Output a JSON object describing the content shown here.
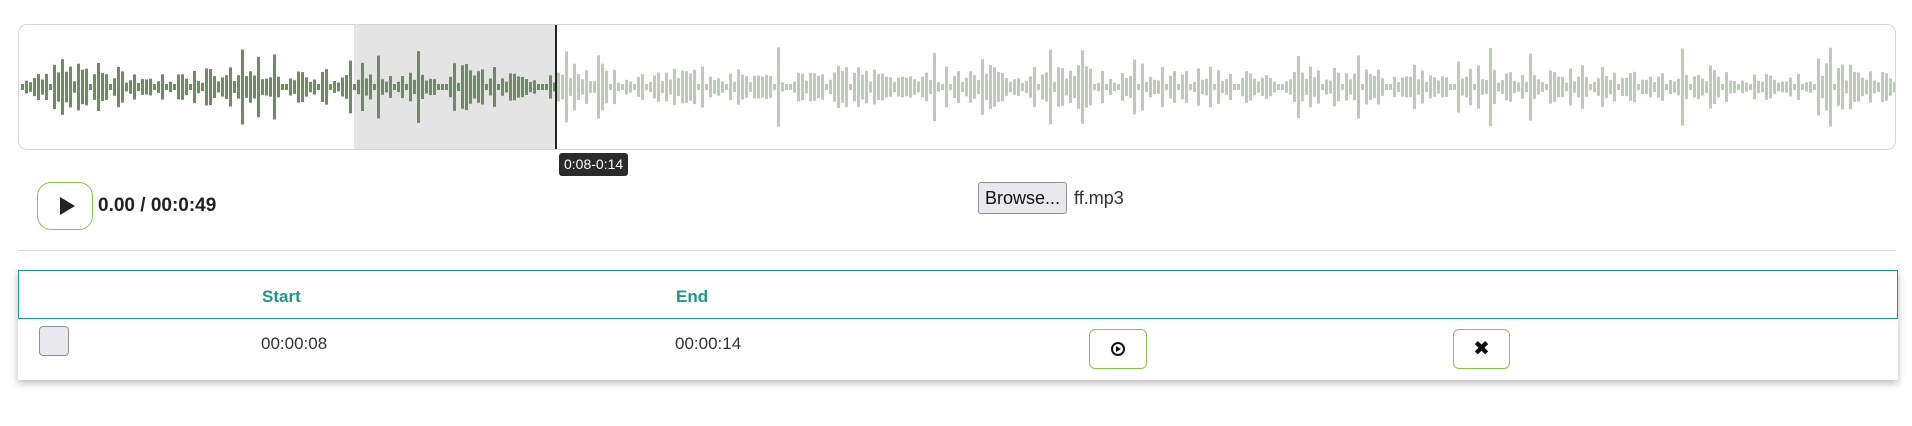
{
  "colors": {
    "wave_played": "#6b8e5e",
    "wave_unplayed": "#bccbb5",
    "selection": "#e4e4e4",
    "cursor": "#222222",
    "accent_green": "#8bc34a",
    "table_teal": "#1c9a86"
  },
  "waveform": {
    "selection_label": "0:08-0:14",
    "played_fraction": 0.2865,
    "selection_start_fraction": 0.1785,
    "selection_end_fraction": 0.2865
  },
  "player": {
    "play_icon": "play-icon",
    "time_display": "0.00 / 00:0:49"
  },
  "file": {
    "browse_label": "Browse...",
    "file_name": "ff.mp3"
  },
  "table": {
    "headers": {
      "select": "",
      "start": "Start",
      "end": "End",
      "play": "",
      "delete": ""
    },
    "rows": [
      {
        "start": "00:00:08",
        "end": "00:00:14",
        "play_icon": "circle-play-icon",
        "delete_icon": "close-icon"
      }
    ]
  }
}
